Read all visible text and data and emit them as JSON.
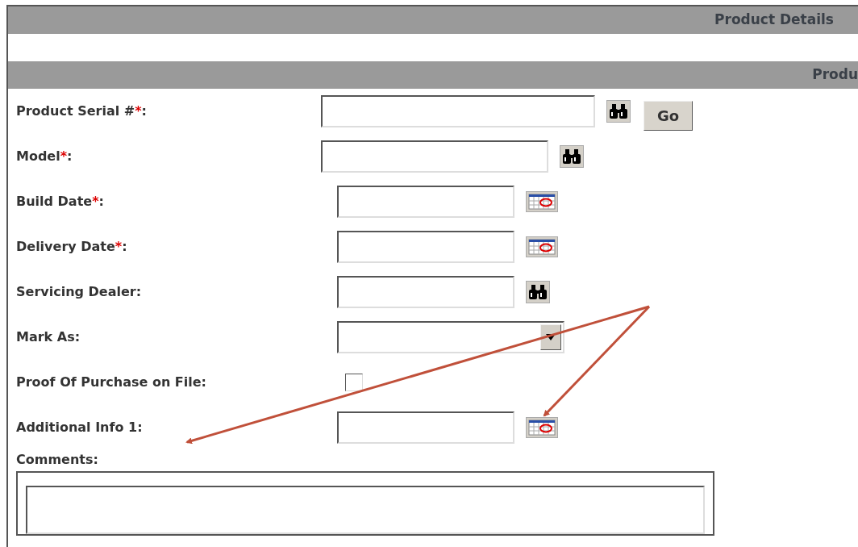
{
  "header_bar": {
    "title": "Product Details"
  },
  "section_bar": {
    "title": "Produ"
  },
  "search_rows": [
    {
      "label": "Product Serial #",
      "required": "*",
      "colon": ":",
      "kind": "lookup_go",
      "button": "Go"
    },
    {
      "label": "Model",
      "required": "*",
      "colon": ":",
      "kind": "lookup"
    }
  ],
  "rows": [
    {
      "label": "Build Date",
      "required": "*",
      "colon": ":",
      "kind": "date"
    },
    {
      "label": "Delivery Date",
      "required": "*",
      "colon": ":",
      "kind": "date"
    },
    {
      "label": "Servicing Dealer",
      "colon": ":",
      "kind": "lookup"
    },
    {
      "label": "Mark As",
      "colon": ":",
      "kind": "select"
    },
    {
      "label": "Proof Of Purchase on File",
      "colon": ":",
      "kind": "checkbox",
      "checked": false
    },
    {
      "label": "Additional Info 1",
      "colon": ":",
      "kind": "date"
    }
  ],
  "comments": {
    "label": "Comments",
    "colon": ":"
  }
}
